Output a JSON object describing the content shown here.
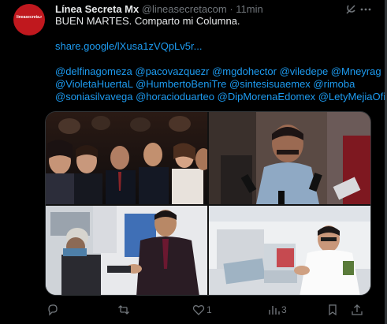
{
  "tweet": {
    "avatar_text": "lineasecreta.mx",
    "display_name": "Línea Secreta Mx",
    "handle": "@lineasecretacom",
    "separator": "·",
    "time": "11min",
    "line1": "BUEN MARTES. Comparto mi Columna.",
    "link": "share.google/lXusa1zVQpLv5r...",
    "mention_lines": [
      "@delfinagomeza @pacovazquezr @mgdohector @viledepe @Mneyrag",
      "@VioletaHuertaL @HumbertoBeniTre @sintesisuaemex @rimoba",
      "@soniasilvavega @horacioduarteo @DipMorenaEdomex @LetyMejiaOfic"
    ]
  },
  "top_icons": [
    "grok-icon",
    "more-icon"
  ],
  "media": {
    "photos": [
      "audience-photo",
      "interview-photo",
      "handshake-photo",
      "lab-photo"
    ]
  },
  "actions": {
    "reply_count": "",
    "retweet_count": "",
    "like_count": "1",
    "views_count": "3",
    "icons": [
      "reply-icon",
      "retweet-icon",
      "like-icon",
      "views-icon",
      "bookmark-icon",
      "share-icon"
    ]
  },
  "colors": {
    "background": "#000000",
    "text": "#e7e9ea",
    "muted": "#71767b",
    "link": "#1d9bf0",
    "avatar": "#c0181e"
  }
}
